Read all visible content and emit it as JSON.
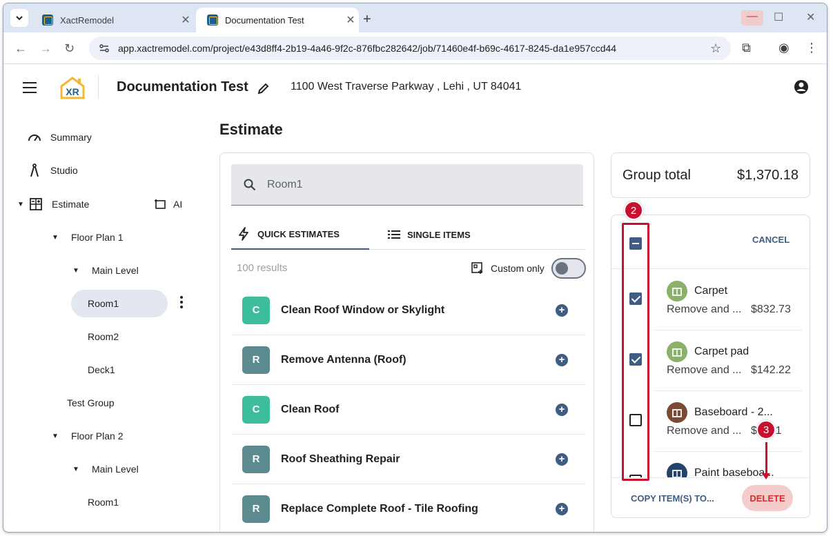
{
  "browser": {
    "tabs": [
      {
        "title": "XactRemodel",
        "active": false
      },
      {
        "title": "Documentation Test",
        "active": true
      }
    ],
    "new_tab": "+",
    "url": "app.xactremodel.com/project/e43d8ff4-2b19-4a46-9f2c-876fbc282642/job/71460e4f-b69c-4617-8245-da1e957ccd44"
  },
  "header": {
    "logo_text": "XR",
    "project_title": "Documentation Test",
    "address": "1100 West Traverse Parkway , Lehi , UT 84041"
  },
  "sidebar": {
    "summary": "Summary",
    "studio": "Studio",
    "estimate": "Estimate",
    "ai": "AI",
    "floor_plan_1": "Floor Plan 1",
    "main_level_1": "Main Level",
    "room1": "Room1",
    "room2": "Room2",
    "deck1": "Deck1",
    "test_group": "Test Group",
    "floor_plan_2": "Floor Plan 2",
    "main_level_2": "Main Level",
    "room1_b": "Room1"
  },
  "estimate": {
    "title": "Estimate",
    "search_value": "Room1",
    "tab_quick": "QUICK ESTIMATES",
    "tab_single": "SINGLE ITEMS",
    "results": "100 results",
    "custom_only": "Custom only",
    "items": [
      {
        "badge": "C",
        "name": "Clean Roof Window or Skylight",
        "color": "#3dbd9b"
      },
      {
        "badge": "R",
        "name": "Remove Antenna (Roof)",
        "color": "#5b8a8f"
      },
      {
        "badge": "C",
        "name": "Clean Roof",
        "color": "#3dbd9b"
      },
      {
        "badge": "R",
        "name": "Roof Sheathing Repair",
        "color": "#5b8a8f"
      },
      {
        "badge": "R",
        "name": "Replace Complete Roof - Tile Roofing",
        "color": "#5b8a8f"
      }
    ]
  },
  "group": {
    "total_label": "Group total",
    "total_value": "$1,370.18",
    "cancel": "CANCEL",
    "items": [
      {
        "name": "Carpet",
        "desc": "Remove and ...",
        "price": "$832.73",
        "checked": true
      },
      {
        "name": "Carpet pad",
        "desc": "Remove and ...",
        "price": "$142.22",
        "checked": true
      },
      {
        "name": "Baseboard - 2...",
        "desc": "Remove and ...",
        "price": "$2..91",
        "checked": false
      },
      {
        "name": "Paint baseboa...",
        "desc": "",
        "price": "",
        "checked": false
      }
    ],
    "copy_button": "COPY ITEM(S) TO...",
    "delete_button": "DELETE"
  },
  "annotations": {
    "step2": "2",
    "step3": "3"
  },
  "colors": {
    "accent": "#3f5d82",
    "annotation": "#c8102e",
    "delete_bg": "#f5cccc"
  }
}
